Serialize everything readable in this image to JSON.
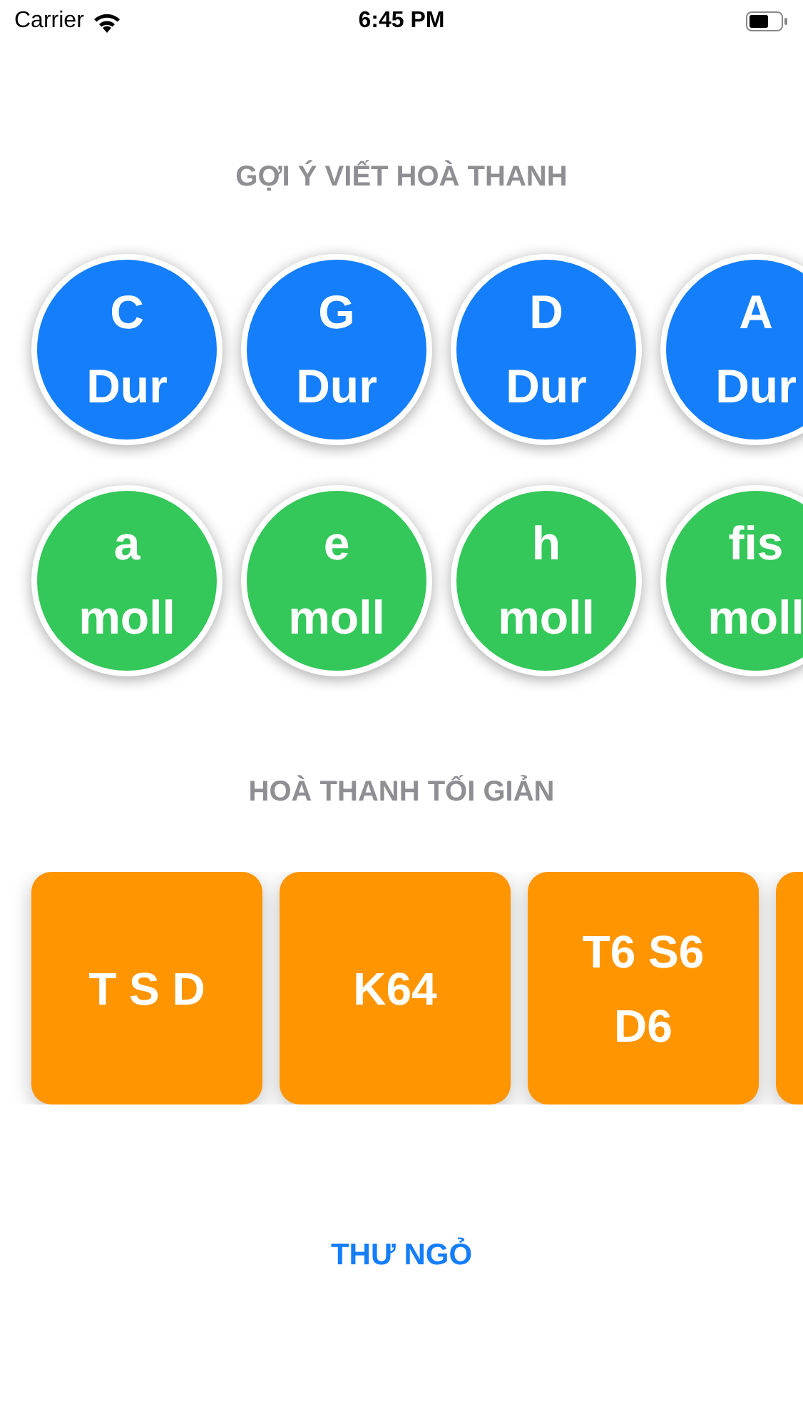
{
  "status_bar": {
    "carrier": "Carrier",
    "time": "6:45 PM"
  },
  "suggest_section": {
    "title": "GỢI Ý VIẾT HOÀ THANH",
    "rows": [
      {
        "color": "#157efb",
        "keys": [
          {
            "label": "C\nDur"
          },
          {
            "label": "G\nDur"
          },
          {
            "label": "D\nDur"
          },
          {
            "label": "A\nDur"
          }
        ]
      },
      {
        "color": "#34c759",
        "keys": [
          {
            "label": "a\nmoll"
          },
          {
            "label": "e\nmoll"
          },
          {
            "label": "h\nmoll"
          },
          {
            "label": "fis\nmoll"
          }
        ]
      }
    ]
  },
  "simple_section": {
    "title": "HOÀ THANH TỐI GIẢN",
    "cards": [
      {
        "kind": "text",
        "label": "T S D"
      },
      {
        "kind": "text",
        "label": "K64"
      },
      {
        "kind": "text",
        "label": "T6 S6\nD6"
      },
      {
        "kind": "edge"
      }
    ]
  },
  "link": "THƯ NGỎ"
}
